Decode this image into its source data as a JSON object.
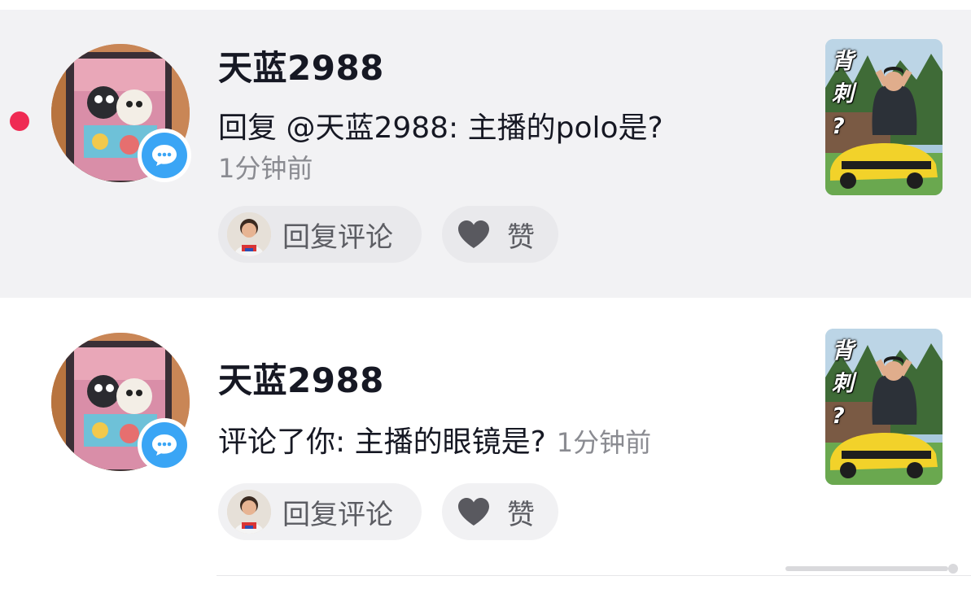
{
  "notifications": [
    {
      "unread": true,
      "username": "天蓝2988",
      "content": "回复 @天蓝2988: 主播的polo是?",
      "time": "1分钟前",
      "reply_button": "回复评论",
      "like_button": "赞",
      "thumbnail_text": [
        "背",
        "刺",
        "?"
      ]
    },
    {
      "unread": false,
      "username": "天蓝2988",
      "content": "评论了你: 主播的眼镜是?",
      "time": "1分钟前",
      "reply_button": "回复评论",
      "like_button": "赞",
      "thumbnail_text": [
        "背",
        "刺",
        "?"
      ]
    }
  ],
  "colors": {
    "unread_bg": "#f2f2f4",
    "unread_dot": "#ef2b53",
    "message_badge": "#3aa5f5",
    "secondary_text": "#8a8b91"
  }
}
